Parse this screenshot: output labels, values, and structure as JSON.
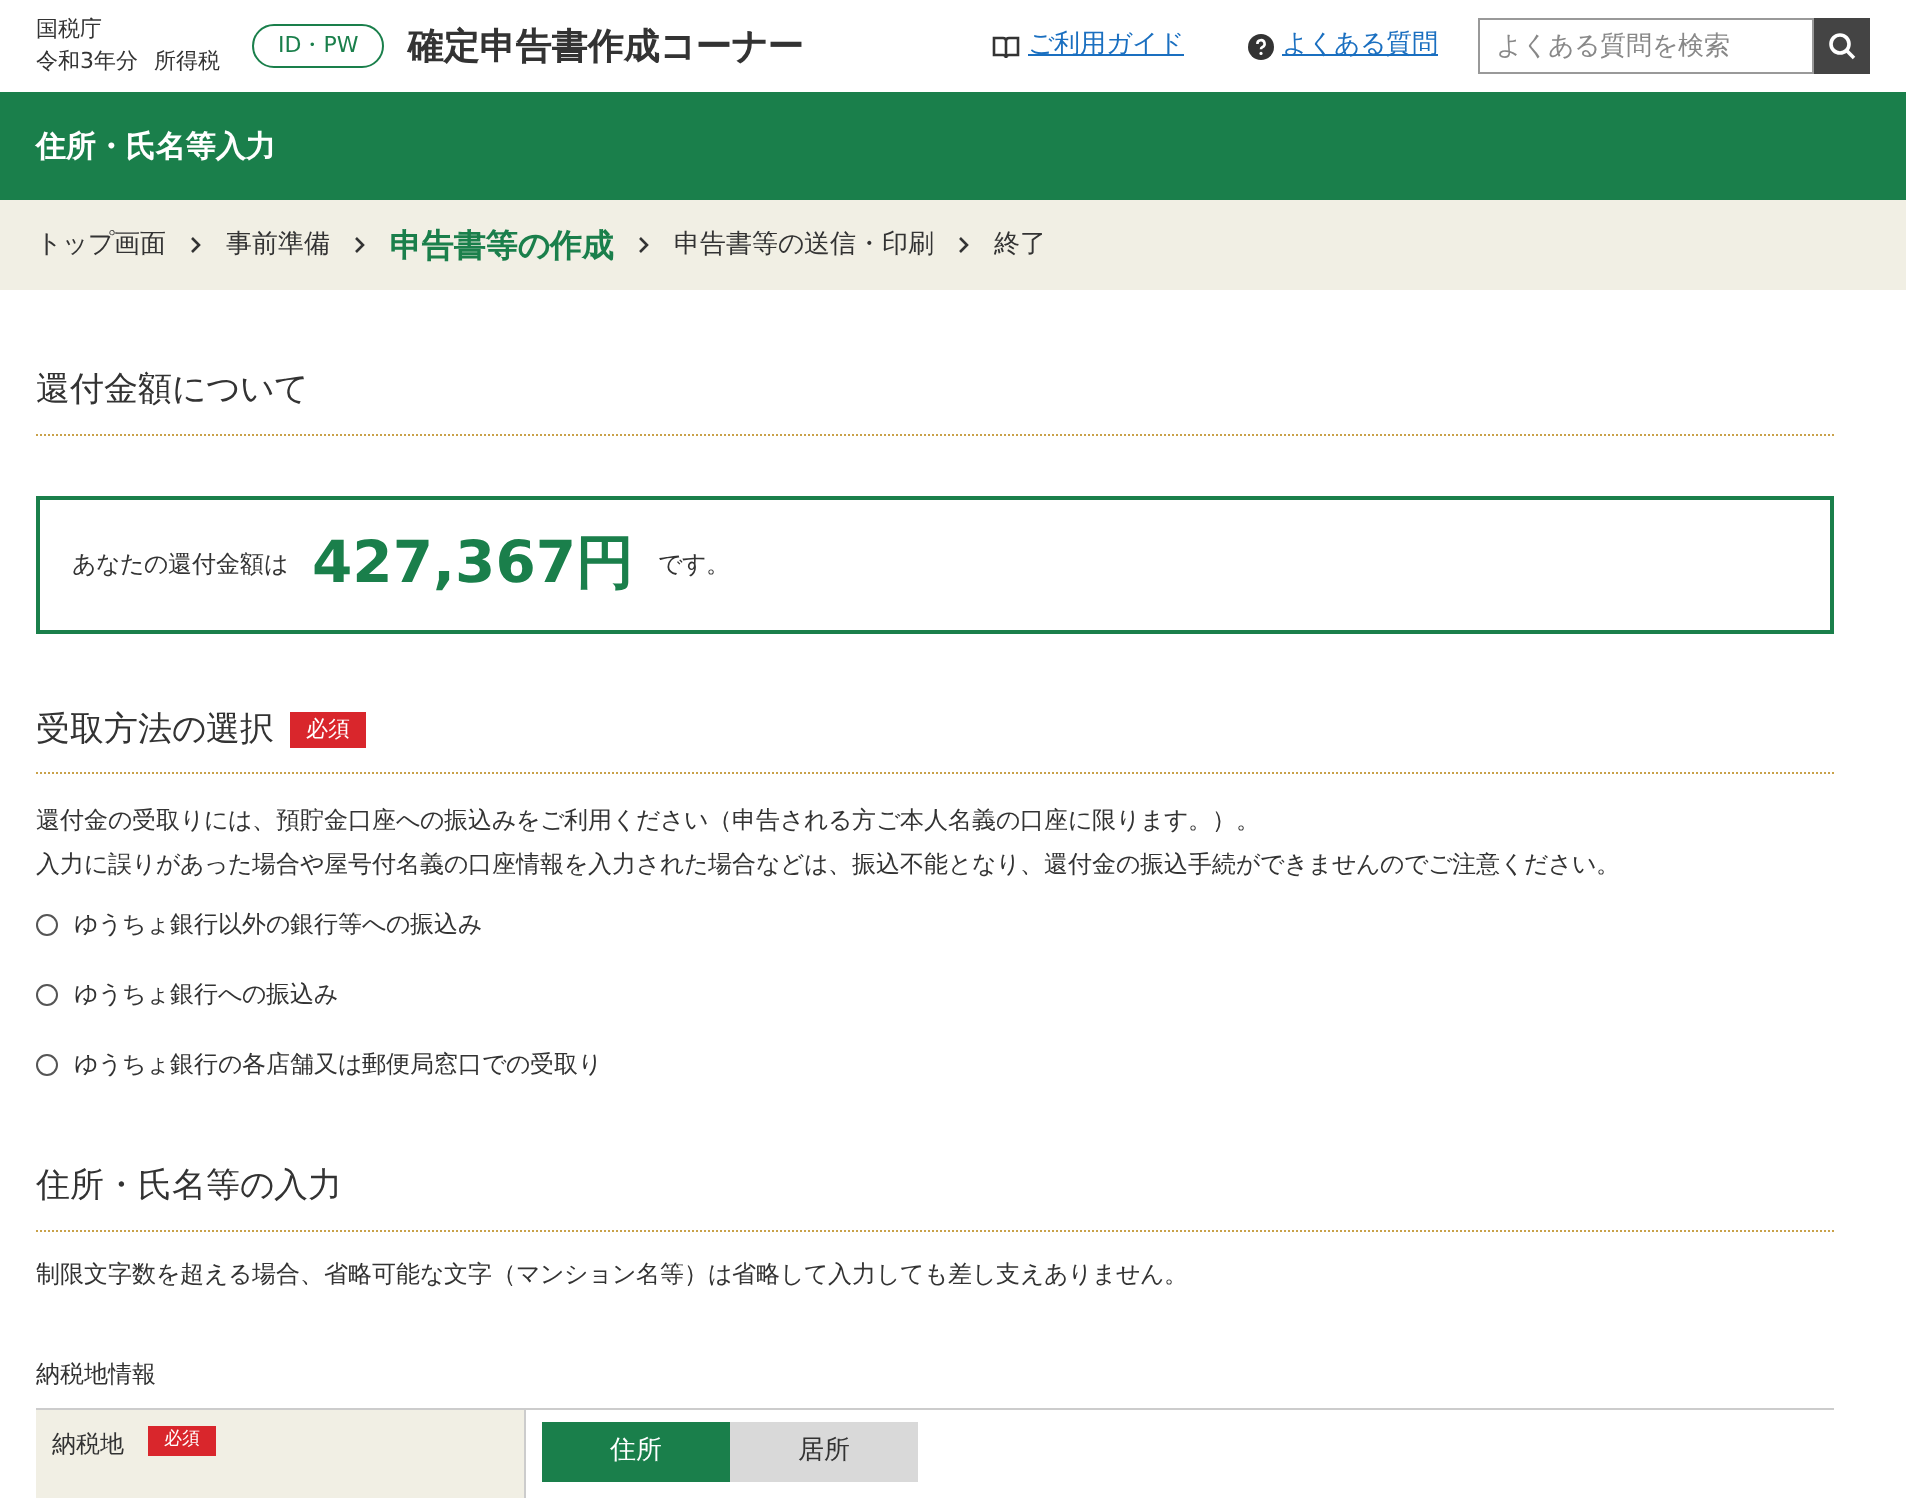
{
  "header": {
    "agency": "国税庁",
    "year": "令和3年分",
    "tax": "所得税",
    "mode_badge": "ID・PW",
    "title": "確定申告書作成コーナー",
    "guide_link": "ご利用ガイド",
    "faq_link": "よくある質問",
    "search": {
      "placeholder": "よくある質問を検索"
    }
  },
  "page_title": "住所・氏名等入力",
  "breadcrumb": [
    {
      "label": "トップ画面",
      "selected": false
    },
    {
      "label": "事前準備",
      "selected": false
    },
    {
      "label": "申告書等の作成",
      "selected": true
    },
    {
      "label": "申告書等の送信・印刷",
      "selected": false
    },
    {
      "label": "終了",
      "selected": false
    }
  ],
  "refund": {
    "heading": "還付金額について",
    "prefix": "あなたの還付金額は",
    "amount": "427,367円",
    "suffix": "です。"
  },
  "receipt": {
    "heading": "受取方法の選択",
    "required": "必須",
    "notes": [
      "還付金の受取りには、預貯金口座への振込みをご利用ください（申告される方ご本人名義の口座に限ります。）。",
      "入力に誤りがあった場合や屋号付名義の口座情報を入力された場合などは、振込不能となり、還付金の振込手続ができませんのでご注意ください。"
    ],
    "options": [
      {
        "label": "ゆうちょ銀行以外の銀行等への振込み",
        "selected": false
      },
      {
        "label": "ゆうちょ銀行への振込み",
        "selected": false
      },
      {
        "label": "ゆうちょ銀行の各店舗又は郵便局窓口での受取り",
        "selected": false
      }
    ]
  },
  "address": {
    "heading": "住所・氏名等の入力",
    "note": "制限文字数を超える場合、省略可能な文字（マンション名等）は省略して入力しても差し支えありません。",
    "subheading": "納税地情報",
    "field_label": "納税地",
    "required": "必須",
    "toggles": [
      {
        "label": "住所",
        "selected": true
      },
      {
        "label": "居所",
        "selected": false
      }
    ]
  }
}
